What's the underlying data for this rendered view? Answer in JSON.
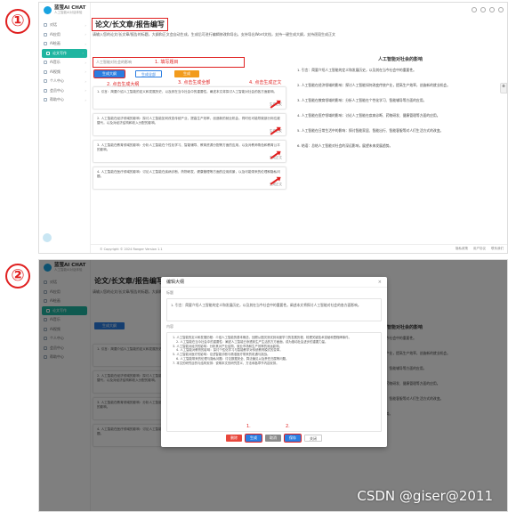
{
  "badges": {
    "one": "①",
    "two": "②"
  },
  "app": {
    "name": "蓝萤AI CHAT",
    "subtitle": "人工智能AI对话体验",
    "nav": [
      {
        "icon": "chat-icon",
        "label": "对话"
      },
      {
        "icon": "grid-icon",
        "label": "AI应用"
      },
      {
        "icon": "image-icon",
        "label": "AI绘画"
      },
      {
        "icon": "doc-icon",
        "label": "论文写作",
        "active": true
      },
      {
        "icon": "music-icon",
        "label": "AI音乐"
      },
      {
        "icon": "video-icon",
        "label": "AI视频"
      },
      {
        "icon": "user-icon",
        "label": "个人中心"
      },
      {
        "icon": "cart-icon",
        "label": "会员中心"
      },
      {
        "icon": "book-icon",
        "label": "帮助中心"
      }
    ],
    "footer_left": "© Copyright © 2024 Ranger Version 1.1",
    "footer_links": [
      "隐私政策",
      "用户协议",
      "联系我们"
    ]
  },
  "page": {
    "title": "论文/长文章/报告编写",
    "desc": "请输入您的论文/长文章/报告的标题，大纲和正文会自动生成，生成后可进行编辑修改和导出，支持导出Word文档，支持一键生成大纲，支持逐段生成正文",
    "topic_placeholder": "人工智能对社会的影响",
    "step1": "1. 填写题目",
    "step2": "2. 点击生成大纲",
    "step3": "3. 点击生成全部",
    "step4": "4. 点击生成正文",
    "btn_outline": "生成大纲",
    "btn_all": "生成全部",
    "btn_gen": "生成",
    "cards": [
      {
        "text": "1. 引言：简要介绍人工智能的定义和发展历史，以及其在当今社会中的重要性。阐述本文将探讨人工智能对社会的各方面影响。",
        "footer": "生成正文"
      },
      {
        "text": "2. 人工智能在经济领域的影响：探讨人工智能如何改变传统产业，提高生产效率，创造新的就业机会，同时也可能导致部分岗位被替代，以及对经济结构和收入分配的影响。",
        "footer": "生成正文"
      },
      {
        "text": "3. 人工智能在教育领域的影响：分析人工智能在个性化学习、智能辅导、教育资源分配等方面的应用，以及对教师角色和教育公平的影响。",
        "footer": "生成正文"
      },
      {
        "text": "4. 人工智能在医疗领域的影响：讨论人工智能在疾病诊断、药物研发、健康管理等方面的应用前景，以及可能带来的伦理和隐私问题。",
        "footer": "生成正文"
      }
    ],
    "report_title": "人工智能对社会的影响",
    "report_paragraphs": [
      "1. 引言：简要介绍人工智能的定义和发展历史，以及其在当今社会中的重要性。",
      "2. 人工智能在经济领域的影响：探讨人工智能如何改变传统产业，提高生产效率，创造新的就业机会。",
      "3. 人工智能在教育领域的影响：分析人工智能在个性化学习、智能辅导等方面的应用。",
      "4. 人工智能在医疗领域的影响：讨论人工智能在疾病诊断、药物研发、健康管理等方面的应用。",
      "5. 人工智能在日常生活中的影响：探讨智能家居、智能出行、智能客服等对人们生活方式的改变。",
      "6. 结语：总结人工智能对社会的深远影响，展望未来发展趋势。"
    ]
  },
  "modal": {
    "title": "编辑大纲",
    "close": "×",
    "label_title": "标题",
    "title_value": "1. 引言：简要介绍人工智能的定义和发展历史，以及其在当今社会中的重要性。阐述本文将探讨人工智能对社会的各方面影响。",
    "label_body": "内容",
    "body_lines": [
      "1. 人工智能的定义和发展历程：介绍人工智能的基本概念，回顾从图灵测试到深度学习的发展历程，梳理关键技术突破和里程碑事件。",
      "2. 人工智能在当今社会中的重要性：阐述人工智能已渗透到生产生活的方方面面，成为推动社会进步的重要力量。",
      "3. 人工智能对经济的影响：分析其对产业结构、就业市场和生产效率的深远影响。",
      "4. 人工智能对教育的影响：探讨个性化学习与智能教学对传统教育模式的变革。",
      "5. 人工智能对医疗的影响：论述智能诊断与精准医疗带来的机遇与挑战。",
      "6. 人工智能带来的伦理与隐私问题：讨论数据安全、算法偏见以及责任归属等问题。",
      "7. 本文的研究目的与结构安排：说明本文的研究意义、方法和各章节内容安排。"
    ],
    "buttons": [
      "删除",
      "生成",
      "取消",
      "保存",
      "关闭"
    ],
    "notes": [
      "1.",
      "2."
    ]
  },
  "watermark": "CSDN @giser@2011"
}
